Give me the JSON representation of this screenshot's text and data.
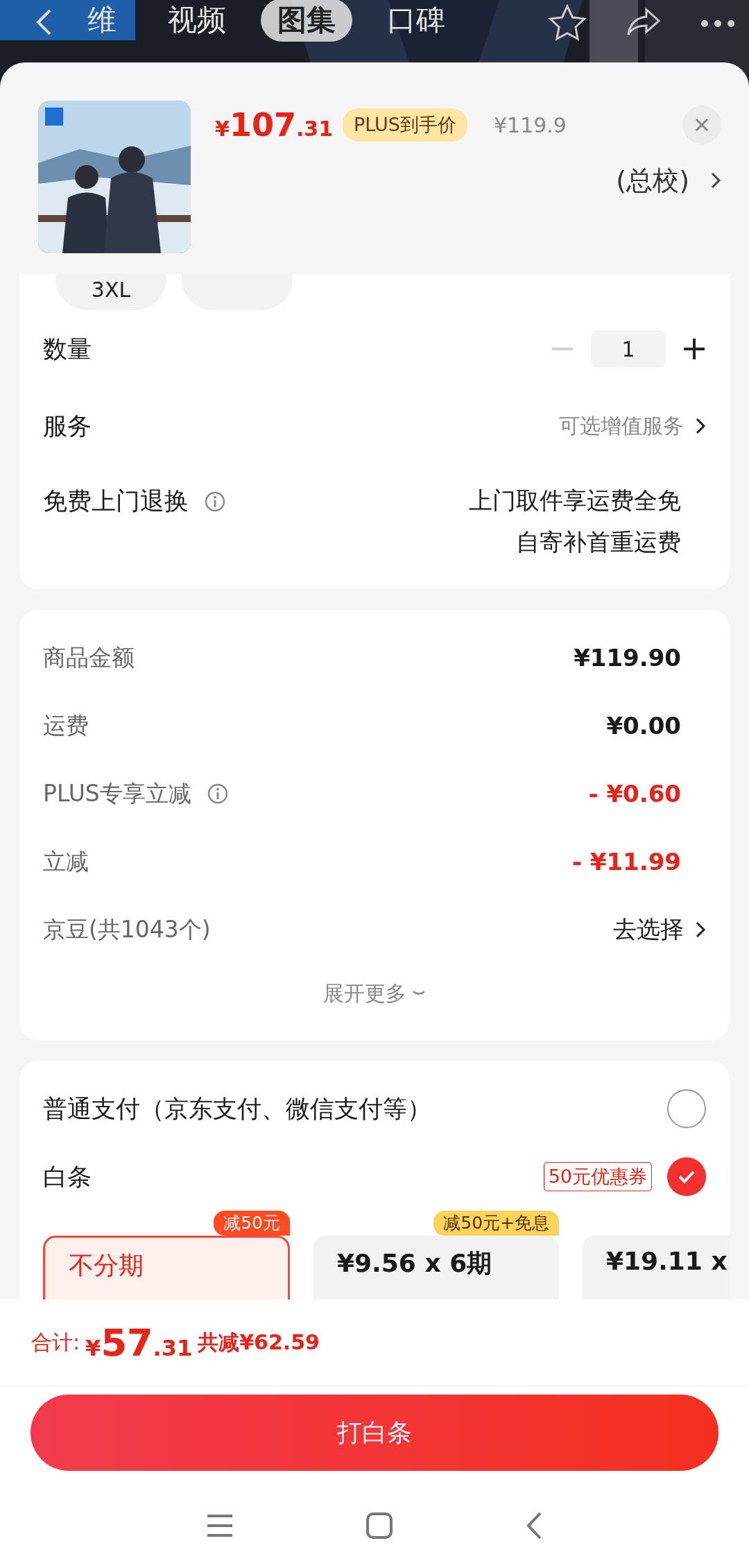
{
  "top_bar": {
    "tabs": [
      {
        "label": "维",
        "selected": false
      },
      {
        "label": "视频",
        "selected": false
      },
      {
        "label": "图集",
        "selected": true
      },
      {
        "label": "口碑",
        "selected": false
      }
    ]
  },
  "product": {
    "price_symbol": "¥",
    "price_int": "107",
    "price_dec": ".31",
    "badge": "PLUS到手价",
    "original_price": "¥119.9",
    "subtitle": "(总校)"
  },
  "sizes": [
    {
      "kind": "text",
      "label": "3XL"
    },
    {
      "kind": "hidden"
    }
  ],
  "quantity": {
    "label": "数量",
    "value": "1",
    "minus_disabled": true
  },
  "service": {
    "label": "服务",
    "value": "可选增值服务"
  },
  "free_return": {
    "label": "免费上门退换",
    "lines": [
      "上门取件享运费全免",
      "自寄补首重运费"
    ]
  },
  "costs": [
    {
      "label": "商品金额",
      "value": "¥119.90",
      "kind": "plain",
      "info": false
    },
    {
      "label": "运费",
      "value": "¥0.00",
      "kind": "plain",
      "info": false
    },
    {
      "label": "PLUS专享立减",
      "value": "- ¥0.60",
      "kind": "discount",
      "info": true
    },
    {
      "label": "立减",
      "value": "- ¥11.99",
      "kind": "discount",
      "info": false
    },
    {
      "label": "京豆(共1043个)",
      "value": "去选择",
      "kind": "link",
      "info": false
    }
  ],
  "expand": "展开更多",
  "payment": {
    "options": [
      {
        "label": "普通支付（京东支付、微信支付等）",
        "selected": false
      },
      {
        "label": "白条",
        "coupon": "50元优惠券",
        "selected": true
      }
    ],
    "plans": [
      {
        "label": "不分期",
        "tag": "减50元",
        "color": "#ff4a22",
        "selected": true
      },
      {
        "label": "¥9.56 x 6期",
        "tag": "减50元+免息",
        "color": "#ffd35a",
        "selected": false
      },
      {
        "label": "¥19.11 x",
        "selected": false
      }
    ]
  },
  "footer": {
    "total_label": "合计:",
    "total_symbol": "¥",
    "total_int": "57",
    "total_dec": ".31",
    "saved": "共减¥62.59",
    "button": "打白条"
  }
}
